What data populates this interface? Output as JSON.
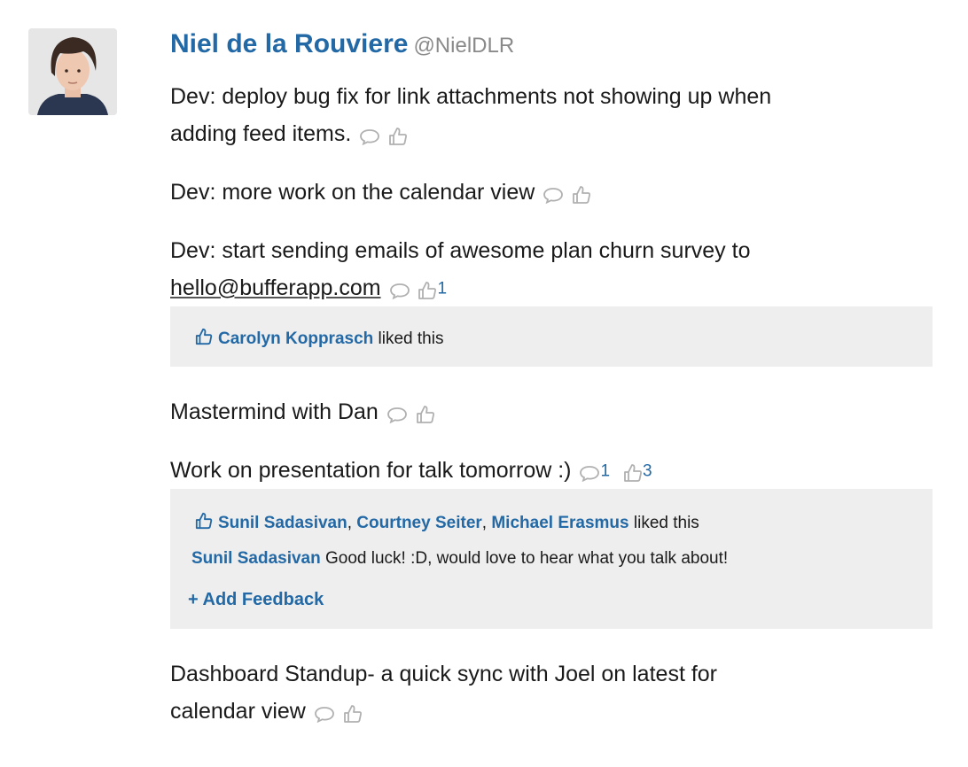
{
  "user": {
    "name": "Niel de la Rouviere",
    "handle": "@NielDLR"
  },
  "updates": [
    {
      "text_lines": [
        "Dev: deploy bug fix for link attachments not showing up when",
        "adding feed items."
      ],
      "comments": "",
      "likes": ""
    },
    {
      "text": "Dev: more work on the calendar view",
      "comments": "",
      "likes": ""
    },
    {
      "text_lines": [
        "Dev: start sending emails of awesome plan churn survey to"
      ],
      "link": "hello@bufferapp.com",
      "comments": "",
      "likes": "1",
      "liked_by": [
        "Carolyn Kopprasch"
      ],
      "liked_suffix": "liked this"
    },
    {
      "text": "Mastermind with Dan",
      "comments": "",
      "likes": ""
    },
    {
      "text": "Work on presentation for talk tomorrow :)",
      "comments": "1",
      "likes": "3",
      "liked_by": [
        "Sunil Sadasivan",
        "Courtney Seiter",
        "Michael Erasmus"
      ],
      "liked_suffix": "liked this",
      "comment": {
        "author": "Sunil Sadasivan",
        "text": "Good luck! :D, would love to hear what you talk about!"
      },
      "add_feedback": "+ Add Feedback"
    },
    {
      "text_lines": [
        "Dashboard Standup- a quick sync with Joel on latest for",
        "calendar view"
      ],
      "comments": "",
      "likes": ""
    }
  ],
  "icons": {
    "comment": "comment-bubble-icon",
    "like": "thumbs-up-icon"
  },
  "colors": {
    "link_blue": "#2369a6",
    "panel_bg": "#eeeeee",
    "handle_gray": "#8a8a8a"
  }
}
